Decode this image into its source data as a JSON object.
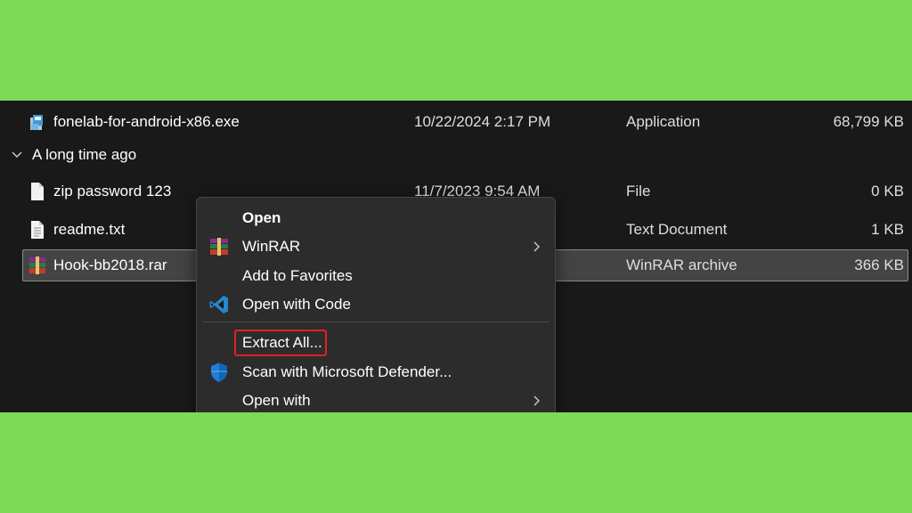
{
  "files": [
    {
      "name": "fonelab-for-android-x86.exe",
      "date": "10/22/2024 2:17 PM",
      "type": "Application",
      "size": "68,799 KB",
      "icon": "installer-icon"
    },
    {
      "name": "zip password 123",
      "date": "11/7/2023 9:54 AM",
      "type": "File",
      "size": "0 KB",
      "icon": "file-icon"
    },
    {
      "name": "readme.txt",
      "date": "",
      "type": "Text Document",
      "size": "1 KB",
      "icon": "text-file-icon"
    },
    {
      "name": "Hook-bb2018.rar",
      "date": "",
      "type": "WinRAR archive",
      "size": "366 KB",
      "icon": "winrar-icon"
    }
  ],
  "group_header": "A long time ago",
  "context_menu": {
    "items": [
      {
        "label": "Open",
        "icon": "",
        "submenu": false
      },
      {
        "label": "WinRAR",
        "icon": "winrar-icon",
        "submenu": true
      },
      {
        "label": "Add to Favorites",
        "icon": "",
        "submenu": false
      },
      {
        "label": "Open with Code",
        "icon": "vscode-icon",
        "submenu": false
      },
      {
        "label": "Extract All...",
        "icon": "",
        "submenu": false
      },
      {
        "label": "Scan with Microsoft Defender...",
        "icon": "defender-shield-icon",
        "submenu": false
      },
      {
        "label": "Open with",
        "icon": "",
        "submenu": true
      }
    ]
  },
  "colors": {
    "background": "#7ed957",
    "explorer_bg": "#191919",
    "menu_bg": "#2c2c2c",
    "highlight_border": "#e0202a"
  }
}
